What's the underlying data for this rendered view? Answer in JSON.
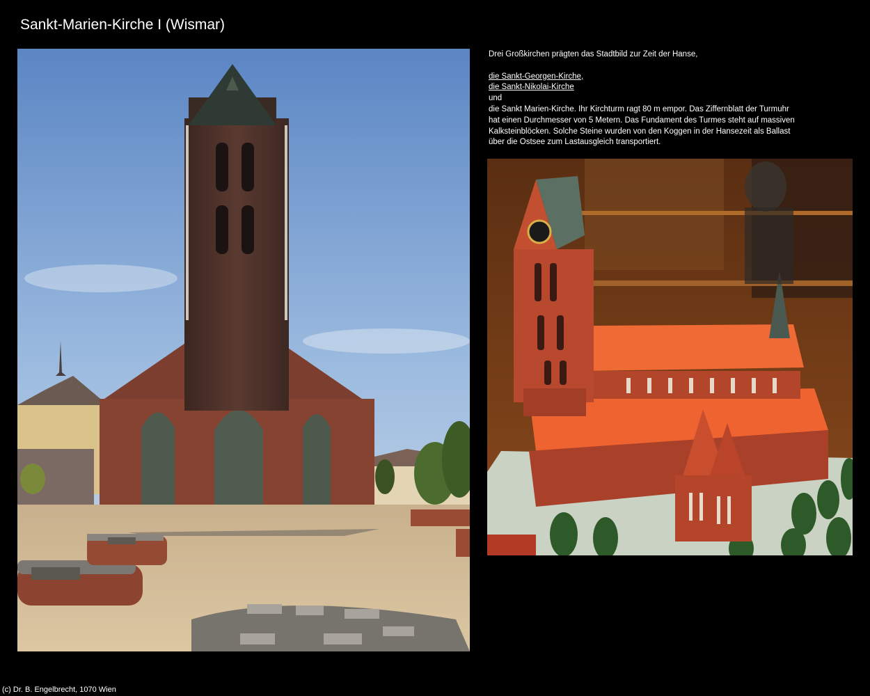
{
  "page": {
    "title": "Sankt-Marien-Kirche I (Wismar)"
  },
  "description": {
    "intro": "Drei Großkirchen prägten das Stadtbild zur Zeit der Hanse,",
    "links": [
      {
        "label": "die Sankt-Georgen-Kirche,"
      },
      {
        "label": "die Sankt-Nikolai-Kirche"
      }
    ],
    "connector": "und",
    "body_lines": [
      "die Sankt Marien-Kirche. Ihr Kirchturm ragt 80 m empor. Das Ziffernblatt der Turmuhr",
      "hat einen Durchmesser von 5 Metern. Das Fundament des Turmes steht auf massiven",
      "Kalksteinblöcken. Solche Steine wurden von den Koggen in der Hansezeit als Ballast",
      "über die Ostsee zum Lastausgleich transportiert."
    ]
  },
  "footer": {
    "copyright": "(c) Dr. B. Engelbrecht, 1070 Wien"
  }
}
